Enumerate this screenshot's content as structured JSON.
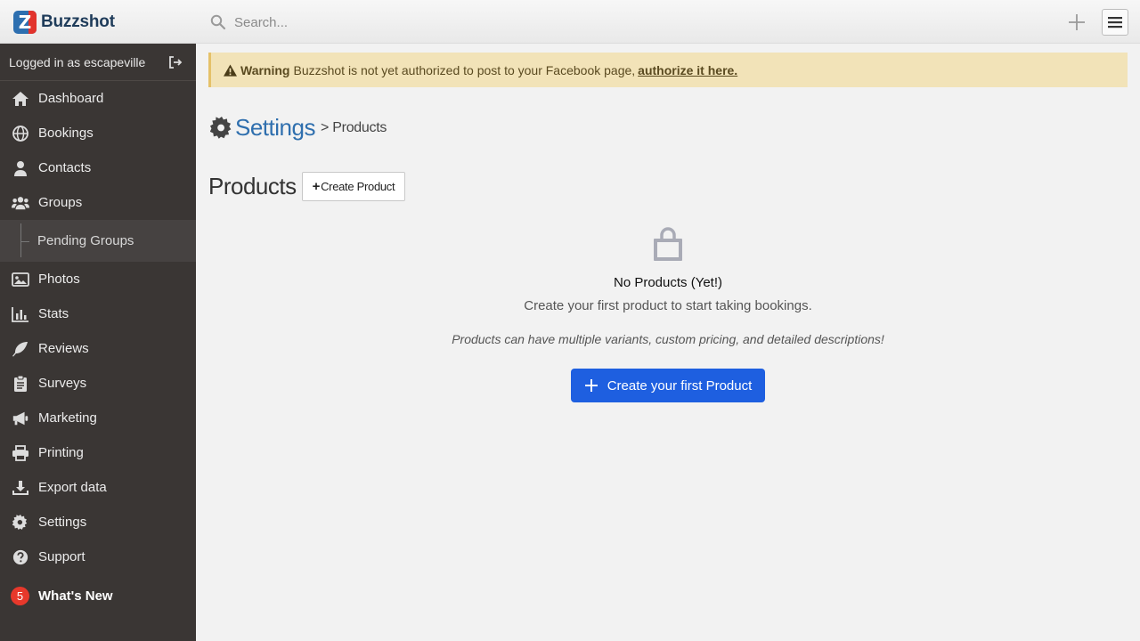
{
  "brand": {
    "name": "Buzzshot"
  },
  "search": {
    "placeholder": "Search..."
  },
  "user": {
    "logged_in_text": "Logged in as escapeville"
  },
  "sidebar": {
    "items": [
      {
        "label": "Dashboard",
        "icon": "home-icon"
      },
      {
        "label": "Bookings",
        "icon": "globe-icon"
      },
      {
        "label": "Contacts",
        "icon": "user-icon"
      },
      {
        "label": "Groups",
        "icon": "users-icon"
      },
      {
        "label": "Pending Groups",
        "icon": ""
      },
      {
        "label": "Photos",
        "icon": "image-icon"
      },
      {
        "label": "Stats",
        "icon": "bar-chart-icon"
      },
      {
        "label": "Reviews",
        "icon": "feather-icon"
      },
      {
        "label": "Surveys",
        "icon": "clipboard-icon"
      },
      {
        "label": "Marketing",
        "icon": "megaphone-icon"
      },
      {
        "label": "Printing",
        "icon": "printer-icon"
      },
      {
        "label": "Export data",
        "icon": "download-icon"
      },
      {
        "label": "Settings",
        "icon": "gear-icon"
      },
      {
        "label": "Support",
        "icon": "question-icon"
      }
    ],
    "whats_new": {
      "label": "What's New",
      "count": "5"
    }
  },
  "warning": {
    "label": "Warning",
    "message": "Buzzshot is not yet authorized to post to your Facebook page,",
    "link": "authorize it here."
  },
  "breadcrumb": {
    "root": "Settings",
    "separator": ">",
    "current": "Products"
  },
  "products": {
    "heading": "Products",
    "create_button": "Create Product",
    "empty_title": "No Products (Yet!)",
    "empty_subtitle": "Create your first product to start taking bookings.",
    "empty_note": "Products can have multiple variants, custom pricing, and detailed descriptions!",
    "primary_button": "Create your first Product"
  },
  "colors": {
    "sidebar_bg": "#3a3634",
    "accent_blue": "#2f6fae",
    "primary_button": "#1e5fe0",
    "warning_bg": "#f2e3b8",
    "badge_red": "#e7382b"
  }
}
